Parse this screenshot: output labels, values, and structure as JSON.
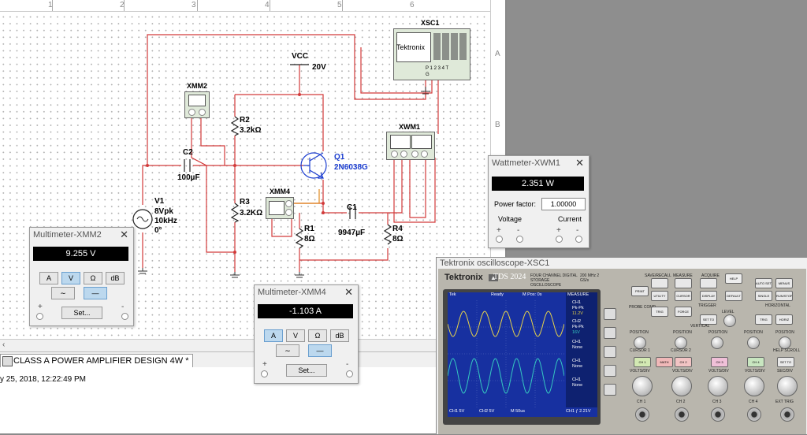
{
  "ruler": {
    "cols": [
      "1",
      "2",
      "3",
      "4",
      "5",
      "6"
    ],
    "rows": [
      "A",
      "B"
    ]
  },
  "document_tab": "CLASS A POWER AMPLIFIER DESIGN 4W *",
  "status_text": "y 25, 2018, 12:22:49 PM",
  "schematic": {
    "vcc": {
      "name": "VCC",
      "value": "20V"
    },
    "r2": {
      "name": "R2",
      "value": "3.2kΩ"
    },
    "r3": {
      "name": "R3",
      "value": "3.2KΩ"
    },
    "r1": {
      "name": "R1",
      "value": "8Ω"
    },
    "r4": {
      "name": "R4",
      "value": "8Ω"
    },
    "c2": {
      "name": "C2",
      "value": "100µF"
    },
    "c1": {
      "name": "C1",
      "value": "9947µF"
    },
    "q1": {
      "name": "Q1",
      "value": "2N6038G"
    },
    "v1": {
      "name": "V1",
      "line1": "8Vpk",
      "line2": "10kHz",
      "line3": "0°"
    },
    "xmm2": "XMM2",
    "xmm4": "XMM4",
    "xwm1": "XWM1",
    "xsc1": "XSC1",
    "xsc_brand": "Tektronix",
    "xsc_pins": "P 1 2 3 4 T",
    "xsc_g": "G"
  },
  "mm2": {
    "title": "Multimeter-XMM2",
    "reading": "9.255 V",
    "modes": [
      "A",
      "V",
      "Ω",
      "dB"
    ],
    "active": "V",
    "set": "Set...",
    "plus": "+",
    "minus": "-"
  },
  "mm4": {
    "title": "Multimeter-XMM4",
    "reading": "-1.103 A",
    "modes": [
      "A",
      "V",
      "Ω",
      "dB"
    ],
    "active": "A",
    "set": "Set...",
    "plus": "+",
    "minus": "-"
  },
  "wattmeter": {
    "title": "Wattmeter-XWM1",
    "reading": "2.351 W",
    "pf_label": "Power factor:",
    "pf_value": "1.00000",
    "voltage": "Voltage",
    "current": "Current",
    "plus": "+",
    "minus": "-"
  },
  "scope": {
    "title": "Tektronix oscilloscope-XSC1",
    "brand": "Tektronix",
    "model": "TDS 2024",
    "model_sub": "FOUR CHANNEL DIGITAL STORAGE OSCILLOSCOPE",
    "model_spec": "200 MHz 2 GS/s",
    "screen": {
      "top_left": "Tek",
      "status": "Ready",
      "mpos": "M Pos: 0s",
      "measure": "MEASURE",
      "m1": [
        "CH1",
        "Pk-Pk",
        "11.2V"
      ],
      "m2": [
        "CH2",
        "Pk-Pk",
        "16V"
      ],
      "m3": [
        "CH1",
        "None"
      ],
      "m4": [
        "CH1",
        "None"
      ],
      "m5": [
        "CH1",
        "None"
      ],
      "ch1": "CH1 5V",
      "ch2": "CH2 5V",
      "time": "M 50us",
      "trig": "CH1 ƒ 2.21V"
    },
    "channels": [
      "CH 1",
      "CH 2",
      "CH 3",
      "CH 4"
    ],
    "ext_trig": "EXT TRIG",
    "probe_comp": "PROBE COMP",
    "buttons": {
      "save_recall": "SAVE/RECALL",
      "measure": "MEASURE",
      "acquire": "ACQUIRE",
      "help": "HELP",
      "utility": "UTILITY",
      "cursor": "CURSOR",
      "display": "DISPLAY",
      "default_setup": "DEFAULT SETUP",
      "auto_set": "AUTO SET",
      "single_seq": "SINGLE SEQ",
      "run_stop": "RUN/STOP",
      "print": "PRINT",
      "menus": "MENUS",
      "trig_view": "TRIG VIEW",
      "force_trig": "FORCE TRIG",
      "set_50": "SET TO 50%",
      "trig_menu": "TRIG MENU",
      "set_zero": "SET TO ZERO",
      "horiz": "HORIZ MENU",
      "ch1_menu": "CH 1 MENU",
      "math_menu": "MATH MENU",
      "ch2_menu": "CH 2 MENU",
      "ch3_menu": "CH 3 MENU",
      "ch4_menu": "CH 4 MENU",
      "trigger": "TRIGGER",
      "vertical": "VERTICAL",
      "horizontal": "HORIZONTAL",
      "level": "LEVEL",
      "position": "POSITION",
      "volts_div": "VOLTS/DIV",
      "sec_div": "SEC/DIV",
      "cursor1": "CURSOR 1",
      "cursor2": "CURSOR 2",
      "help_scroll": "HELP SCROLL"
    }
  },
  "colors": {
    "wire": "#d23a3a",
    "ch1": "#e6d24a",
    "ch2": "#35c8c0",
    "screen": "#1730a0",
    "meter_on": "#bcd8ee"
  }
}
